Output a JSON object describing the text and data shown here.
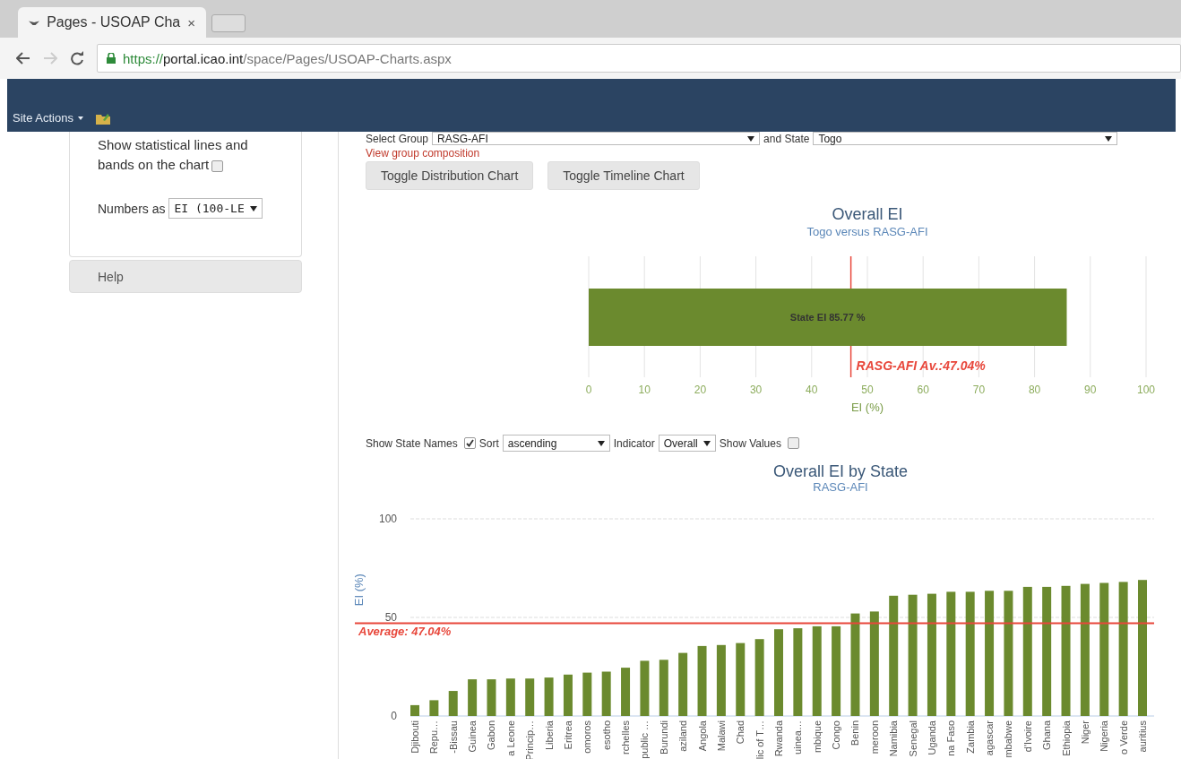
{
  "browser": {
    "tab": {
      "title": "Pages - USOAP Cha",
      "close": "×"
    },
    "address": {
      "scheme": "https://",
      "host": "portal.icao.int",
      "path": "/space/Pages/USOAP-Charts.aspx"
    },
    "forward_disabled": true
  },
  "ribbon": {
    "site_actions": "Site Actions"
  },
  "sidebar": {
    "stat_lines_label": "Show statistical lines and bands on the chart",
    "stat_lines_checked": false,
    "numbers_label": "Numbers as",
    "numbers_value": "EI (100-LE",
    "help": "Help"
  },
  "filters": {
    "group_label": "Select Group",
    "group_value": "RASG-AFI",
    "state_label": "and State",
    "state_value": "Togo",
    "composition_link": "View group composition"
  },
  "buttons": [
    "Toggle Distribution Chart",
    "Toggle Timeline Chart"
  ],
  "overall_chart": {
    "chart_data": {
      "type": "bar",
      "orientation": "horizontal",
      "title": "Overall EI",
      "subtitle": "Togo versus RASG-AFI",
      "xlabel": "EI (%)",
      "values": [
        85.77
      ],
      "value_labels": [
        "State EI 85.77 %"
      ],
      "xlim": [
        0,
        100
      ],
      "xticks": [
        0,
        10,
        20,
        30,
        40,
        50,
        60,
        70,
        80,
        90,
        100
      ],
      "grid": true,
      "ref_lines": [
        {
          "axis": "x",
          "value": 47.04,
          "label": "RASG-AFI Av.:47.04%"
        }
      ]
    }
  },
  "chart_controls": {
    "names_label": "Show State Names",
    "names_checked": true,
    "sort_label": "Sort",
    "sort_value": "ascending",
    "indicator_label": "Indicator",
    "indicator_value": "Overall",
    "values_label": "Show Values",
    "values_checked": false
  },
  "state_chart": {
    "chart_data": {
      "type": "bar",
      "title": "Overall EI by State",
      "subtitle": "RASG-AFI",
      "ylabel": "EI (%)",
      "ylim": [
        0,
        100
      ],
      "yticks": [
        0,
        50,
        100
      ],
      "categories": [
        "Djibouti",
        "Repu…",
        "-Bissau",
        "Guinea",
        "Gabon",
        "a Leone",
        "Princip…",
        "Liberia",
        "Eritrea",
        "omoros",
        "esotho",
        "rchelles",
        "public …",
        "Burundi",
        "aziland",
        "Angola",
        "Malawi",
        "Chad",
        "lic of T…",
        "Rwanda",
        "uinea…",
        "mbique",
        "Congo",
        "Benin",
        "meroon",
        "Namibia",
        "Senegal",
        "Uganda",
        "na Faso",
        "Zambia",
        "agascar",
        "mbabwe",
        "d'Ivoire",
        "Ghana",
        "Ethiopia",
        "Niger",
        "Nigeria",
        "o Verde",
        "auritius"
      ],
      "values": [
        5.5,
        8,
        12.7,
        18.6,
        18.6,
        19,
        19,
        19.5,
        21,
        22,
        22.5,
        24.5,
        28,
        28.5,
        32,
        35.5,
        36,
        37,
        39,
        44,
        44.5,
        45.5,
        45.5,
        52,
        53,
        61,
        61.5,
        62,
        63,
        63,
        63.5,
        63.5,
        65.5,
        65.5,
        66,
        67,
        67.5,
        68,
        69
      ],
      "grid": true,
      "ref_lines": [
        {
          "axis": "y",
          "value": 47.04,
          "label": "Average: 47.04%"
        }
      ]
    }
  }
}
